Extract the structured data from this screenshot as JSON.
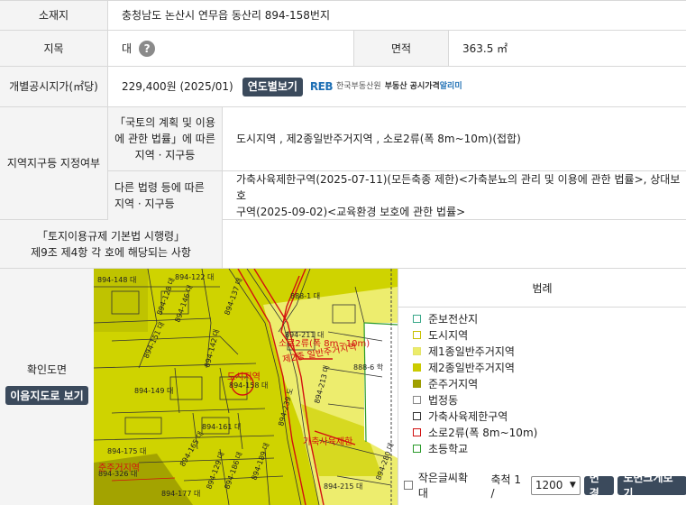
{
  "address": {
    "label": "소재지",
    "value": "충청남도 논산시 연무읍 동산리 894-158번지"
  },
  "jimok": {
    "label": "지목",
    "value": "대",
    "help": "?"
  },
  "area": {
    "label": "면적",
    "value": "363.5 ㎡"
  },
  "price": {
    "label": "개별공시지가(㎡당)",
    "value": "229,400원 (2025/01)",
    "button": "연도별보기",
    "logo_mark": "REB",
    "logo_text1": "한국부동산원",
    "logo_text2": "부동산 공시가격",
    "logo_text3": "알리미"
  },
  "zoning": {
    "label": "지역지구등 지정여부",
    "sub1_label_lines": [
      "「국토의 계획 및 이용",
      "에 관한 법률」에 따른",
      "지역 · 지구등"
    ],
    "sub1_value": "도시지역 , 제2종일반주거지역 , 소로2류(폭 8m~10m)(접합)",
    "sub2_label_lines": [
      "다른 법령 등에 따른",
      "지역 · 지구등"
    ],
    "sub2_value_lines": [
      "가축사육제한구역(2025-07-11)(모든축종 제한)<가축분뇨의 관리 및 이용에 관한 법률>, 상대보호",
      "구역(2025-09-02)<교육환경 보호에 관한 법률>"
    ]
  },
  "article": {
    "label_lines": [
      "「토지이용규제 기본법 시행령」",
      "제9조 제4항 각 호에 해당되는 사항"
    ]
  },
  "confirm": {
    "label": "확인도면",
    "button": "이음지도로 보기"
  },
  "map_labels": {
    "p1": "888-1 대",
    "p2": "894-211 대",
    "p3": "894-149 대",
    "p4": "894-158 대",
    "p5": "894-161 대",
    "p6": "894-175 대",
    "p7": "894-326 대",
    "p8": "894-177 대",
    "p9": "888-6 학",
    "p10": "894-213 대",
    "p11": "894-239 도",
    "p12": "894-142 대",
    "p13": "894-122 대",
    "p14": "894-128 대",
    "p15": "894-137 대",
    "p16": "894-186 대",
    "p17": "894-189 대",
    "p18": "894-215 대",
    "p19": "894-280 대",
    "p20": "894-148 대",
    "r1": "소로2류(폭 8m~10m)",
    "r2": "제2종 일반주거지역",
    "r3": "도시지역",
    "r4": "준주거지역",
    "r5": "가축사육제한",
    "p21": "894-151 대",
    "p22": "894-165 대",
    "p23": "894-146 대",
    "p24": "894-129 대"
  },
  "legend": {
    "title": "범례",
    "items": [
      {
        "label": "준보전산지",
        "color": "#3aa88a",
        "fill": "#ffffff"
      },
      {
        "label": "도시지역",
        "color": "#c8c000",
        "fill": "#ffffff"
      },
      {
        "label": "제1종일반주거지역",
        "color": "#e4e46a",
        "fill": "#ecec6a"
      },
      {
        "label": "제2종일반주거지역",
        "color": "#c8c800",
        "fill": "#cccc00"
      },
      {
        "label": "준주거지역",
        "color": "#9a9a00",
        "fill": "#a0a000"
      },
      {
        "label": "법정동",
        "color": "#888888",
        "fill": "#ffffff"
      },
      {
        "label": "가축사육제한구역",
        "color": "#333333",
        "fill": "#ffffff"
      },
      {
        "label": "소로2류(폭 8m~10m)",
        "color": "#d01010",
        "fill": "#ffffff"
      },
      {
        "label": "초등학교",
        "color": "#2a9a2a",
        "fill": "#ffffff"
      }
    ]
  },
  "controls": {
    "small_text": "작은글씨확대",
    "scale_label": "축척 1 /",
    "scale_value": "1200",
    "apply_button": "변경",
    "enlarge_button": "도면크게보기"
  }
}
